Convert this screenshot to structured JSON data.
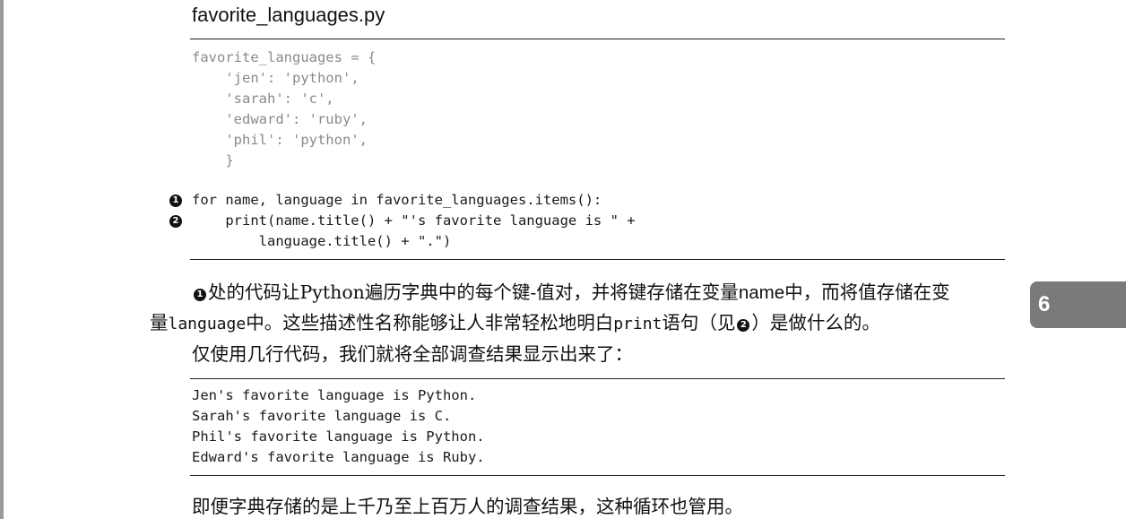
{
  "file_title": "favorite_languages.py",
  "code_dict": [
    "favorite_languages = {",
    "    'jen': 'python',",
    "    'sarah': 'c',",
    "    'edward': 'ruby',",
    "    'phil': 'python',",
    "    }"
  ],
  "code_loop": [
    "for name, language in favorite_languages.items():",
    "    print(name.title() + \"'s favorite language is \" +",
    "        language.title() + \".\")"
  ],
  "markers": {
    "one": "1",
    "two": "2"
  },
  "paragraph1": {
    "l1_a": "处的代码让",
    "l1_python": "Python",
    "l1_b": "遍历字典中的每个键-值对，并将键存储在变量",
    "l1_name": "name",
    "l1_c": "中，而将值存储在变",
    "l2_a": "量",
    "l2_language": "language",
    "l2_b": "中。这些描述性名称能够让人非常轻松地明白",
    "l2_print": "print",
    "l2_c": "语句（见",
    "l2_d": "）是做什么的。",
    "l3": "仅使用几行代码，我们就将全部调查结果显示出来了："
  },
  "output_lines": [
    "Jen's favorite language is Python.",
    "Sarah's favorite language is C.",
    "Phil's favorite language is Python.",
    "Edward's favorite language is Ruby."
  ],
  "paragraph2": "即便字典存储的是上千乃至上百万人的调查结果，这种循环也管用。",
  "chapter_tab": "6"
}
